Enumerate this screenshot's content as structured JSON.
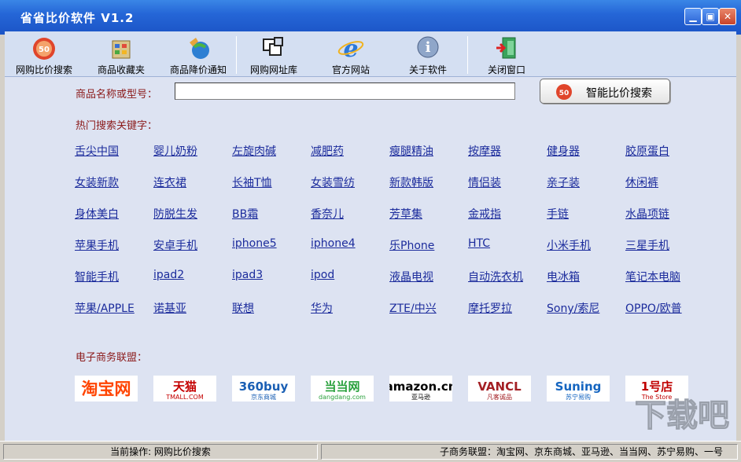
{
  "window": {
    "title": "省省比价软件 V1.2",
    "minimize": "▁",
    "maximize": "▣",
    "close": "✕"
  },
  "toolbar": [
    {
      "label": "网购比价搜索",
      "icon": "search-50-icon"
    },
    {
      "label": "商品收藏夹",
      "icon": "favorites-icon"
    },
    {
      "label": "商品降价通知",
      "icon": "price-alert-icon"
    },
    {
      "label": "网购网址库",
      "icon": "url-library-icon"
    },
    {
      "label": "官方网站",
      "icon": "ie-browser-icon"
    },
    {
      "label": "关于软件",
      "icon": "info-icon"
    },
    {
      "label": "关闭窗口",
      "icon": "exit-door-icon"
    }
  ],
  "search": {
    "label": "商品名称或型号：",
    "value": "",
    "button_label": "智能比价搜索",
    "badge": "50"
  },
  "hot": {
    "label": "热门搜索关键字：",
    "rows": [
      [
        "舌尖中国",
        "婴儿奶粉",
        "左旋肉碱",
        "减肥药",
        "瘦腿精油",
        "按摩器",
        "健身器",
        "胶原蛋白"
      ],
      [
        "女装新款",
        "连衣裙",
        "长袖T恤",
        "女装雪纺",
        "新款韩版",
        "情侣装",
        "亲子装",
        "休闲裤"
      ],
      [
        "身体美白",
        "防脱生发",
        "BB霜",
        "香奈儿",
        "芳草集",
        "金戒指",
        "手链",
        "水晶项链"
      ],
      [
        "苹果手机",
        "安卓手机",
        "iphone5",
        "iphone4",
        "乐Phone",
        "HTC",
        "小米手机",
        "三星手机"
      ],
      [
        "智能手机",
        "ipad2",
        "ipad3",
        "ipod",
        "液晶电视",
        "自动洗衣机",
        "电冰箱",
        "笔记本电脑"
      ],
      [
        "苹果/APPLE",
        "诺基亚",
        "联想",
        "华为",
        "ZTE/中兴",
        "摩托罗拉",
        "Sony/索尼",
        "OPPO/欧普"
      ]
    ]
  },
  "ecommerce": {
    "label": "电子商务联盟：",
    "logos": [
      {
        "name": "taobao",
        "text": "淘宝网",
        "color": "#ff4400"
      },
      {
        "name": "tmall",
        "text": "天猫",
        "sub": "TMALL.COM",
        "color": "#c40000"
      },
      {
        "name": "360buy",
        "text": "360buy",
        "sub": "京东商城",
        "color": "#1a5fb4"
      },
      {
        "name": "dangdang",
        "text": "当当网",
        "sub": "dangdang.com",
        "color": "#2aa13d"
      },
      {
        "name": "amazon",
        "text": "amazon.cn",
        "sub": "亚马逊",
        "color": "#000000"
      },
      {
        "name": "vancl",
        "text": "VANCL",
        "sub": "凡客诚品",
        "color": "#a31f24"
      },
      {
        "name": "suning",
        "text": "Suning",
        "sub": "苏宁易购",
        "color": "#1565c0"
      },
      {
        "name": "yihaodian",
        "text": "1号店",
        "sub": "The Store",
        "color": "#c00000"
      }
    ]
  },
  "watermark": {
    "text": "下载吧"
  },
  "status": {
    "current": "当前操作: 网购比价搜索",
    "marquee": "子商务联盟：淘宝网、京东商城、亚马逊、当当网、苏宁易购、一号"
  }
}
